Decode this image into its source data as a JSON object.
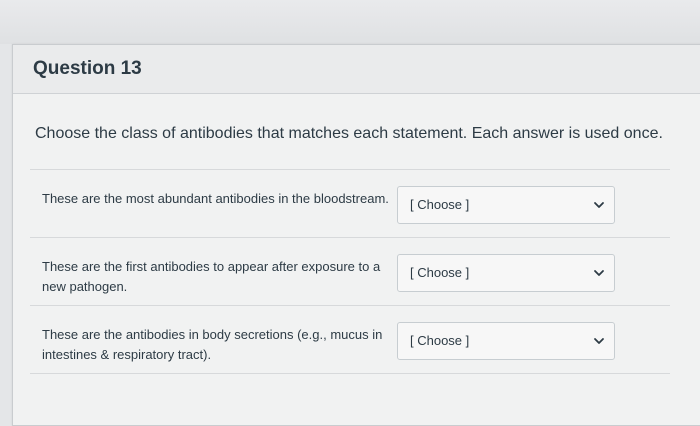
{
  "question": {
    "title": "Question 13",
    "prompt": "Choose the class of antibodies that matches each statement. Each answer is used once."
  },
  "rows": [
    {
      "statement": "These are the most abundant antibodies in the bloodstream.",
      "selected": "[ Choose ]"
    },
    {
      "statement": "These are the first antibodies to appear after exposure to a new pathogen.",
      "selected": "[ Choose ]"
    },
    {
      "statement": "These are the antibodies in body secretions (e.g., mucus in intestines & respiratory tract).",
      "selected": "[ Choose ]"
    }
  ],
  "icons": {
    "dropdown": "chevron-down-icon"
  },
  "colors": {
    "text": "#2d3b45",
    "card_background": "#f1f2f2",
    "header_background": "#eaebec",
    "border": "#c7cdd1"
  }
}
